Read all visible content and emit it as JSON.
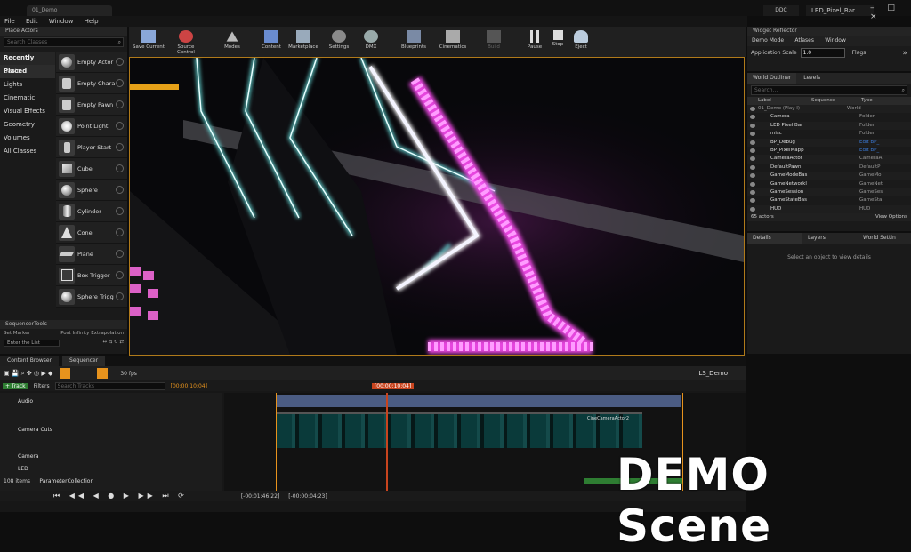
{
  "window": {
    "doc_tab": "01_Demo",
    "ddc": "DDC",
    "project": "LED_Pixel_Bar",
    "controls": "– □ ×"
  },
  "menu": [
    "File",
    "Edit",
    "Window",
    "Help"
  ],
  "place_actors": {
    "title": "Place Actors",
    "search_placeholder": "Search Classes",
    "categories": [
      "Recently Placed",
      "Basic",
      "Lights",
      "Cinematic",
      "Visual Effects",
      "Geometry",
      "Volumes",
      "All Classes"
    ],
    "active_category": "Basic",
    "items": [
      {
        "label": "Empty Actor",
        "icon": "sphere-icon"
      },
      {
        "label": "Empty Chara",
        "icon": "character-icon"
      },
      {
        "label": "Empty Pawn",
        "icon": "pawn-icon"
      },
      {
        "label": "Point Light",
        "icon": "bulb-icon"
      },
      {
        "label": "Player Start",
        "icon": "flag-icon"
      },
      {
        "label": "Cube",
        "icon": "cube-icon"
      },
      {
        "label": "Sphere",
        "icon": "sphere-icon"
      },
      {
        "label": "Cylinder",
        "icon": "cylinder-icon"
      },
      {
        "label": "Cone",
        "icon": "cone-icon"
      },
      {
        "label": "Plane",
        "icon": "plane-icon"
      },
      {
        "label": "Box Trigger",
        "icon": "box-icon"
      },
      {
        "label": "Sphere Trigg",
        "icon": "sphere-icon"
      }
    ]
  },
  "sequencer_tools": {
    "title": "SequencerTools",
    "set_marker": "Set Marker",
    "post_infinity": "Post Infinity Extrapolation",
    "input_value": "Enter the List"
  },
  "toolbar": {
    "buttons": [
      "Save Current",
      "Source Control",
      "Modes",
      "Content",
      "Marketplace",
      "Settings",
      "DMX",
      "Blueprints",
      "Cinematics",
      "Build",
      "Pause",
      "Stop",
      "Eject"
    ]
  },
  "widget_reflector": {
    "title": "Widget Reflector",
    "menu": [
      "Demo Mode",
      "Atlases",
      "Window"
    ],
    "scale_label": "Application Scale",
    "scale_value": "1.0",
    "flags_label": "Flags"
  },
  "world_outliner": {
    "tabs": [
      "World Outliner",
      "Levels"
    ],
    "search_placeholder": "Search...",
    "columns": [
      "Label",
      "Sequence",
      "Type"
    ],
    "rows": [
      {
        "label": "01_Demo (Play I)",
        "type": "World"
      },
      {
        "label": "Camera",
        "type": "Folder"
      },
      {
        "label": "LED Pixel Bar",
        "type": "Folder"
      },
      {
        "label": "misc",
        "type": "Folder"
      },
      {
        "label": "BP_Debug",
        "type": "Edit BP_"
      },
      {
        "label": "BP_PixelMapp",
        "type": "Edit BP_"
      },
      {
        "label": "CameraActor",
        "type": "CameraA"
      },
      {
        "label": "DefaultPawn",
        "type": "DefaultP"
      },
      {
        "label": "GameModeBas",
        "type": "GameMo"
      },
      {
        "label": "GameNetworkl",
        "type": "GameNet"
      },
      {
        "label": "GameSession",
        "type": "GameSes"
      },
      {
        "label": "GameStateBas",
        "type": "GameSta"
      },
      {
        "label": "HUD",
        "type": "HUD"
      }
    ],
    "actor_count": "65 actors",
    "view_options": "View Options"
  },
  "details": {
    "tabs": [
      "Details",
      "Layers",
      "World Settin"
    ],
    "empty_message": "Select an object to view details"
  },
  "bottom": {
    "tabs": [
      "Content Browser",
      "Sequencer"
    ],
    "fps": "30 fps",
    "sequence_name": "LS_Demo",
    "add_track": "+ Track",
    "filters": "Filters",
    "search_tracks": "Search Tracks",
    "current_time": "[00:00:10:04]",
    "time_field": "[00:00:10:04]",
    "tracks": [
      "Audio",
      "Camera Cuts",
      "Camera",
      "LED",
      "MaterialParameterCollection"
    ],
    "items_count": "108 items",
    "start_time": "[-00:01:46:22]",
    "end_time": "[-00:00:04:23]",
    "clip_label": "CineCameraActor2"
  },
  "overlay_text": "DEMO Scene"
}
